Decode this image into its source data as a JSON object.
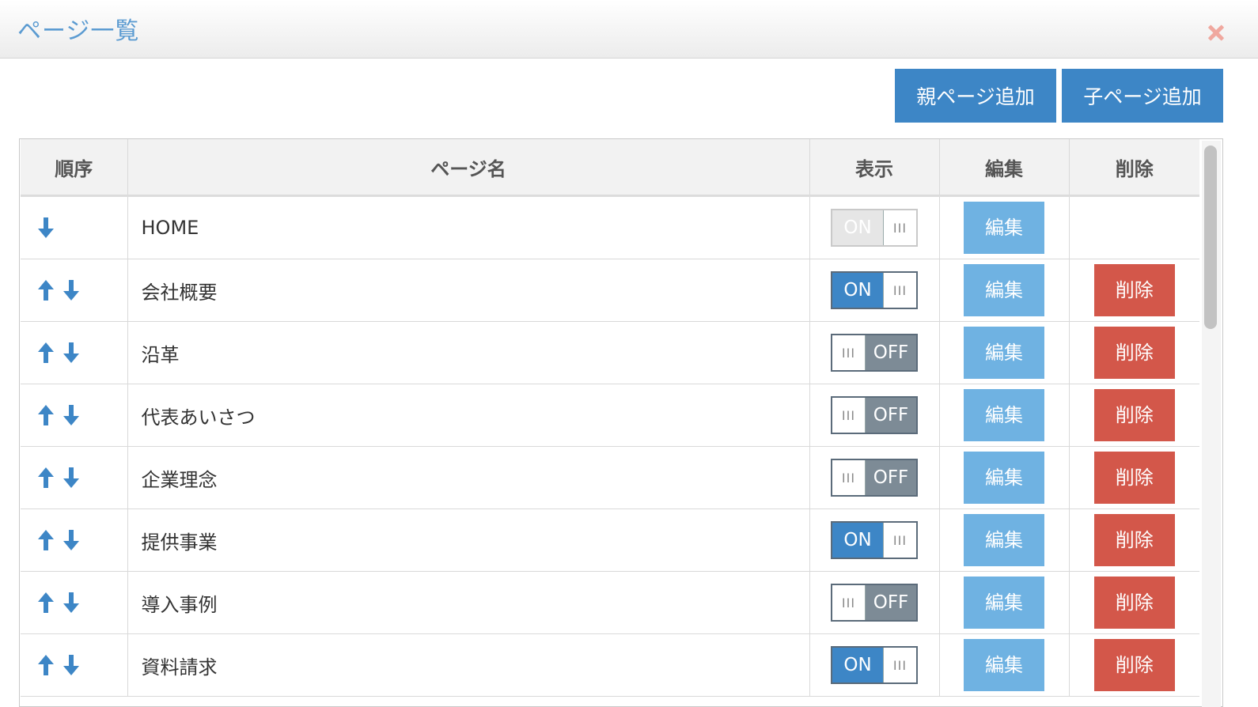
{
  "header": {
    "title": "ページ一覧",
    "close_icon": "close-x-icon",
    "close_color": "#f0a89f"
  },
  "toolbar": {
    "add_parent_label": "親ページ追加",
    "add_child_label": "子ページ追加",
    "accent": "#3d86c6"
  },
  "table": {
    "columns": [
      "順序",
      "ページ名",
      "表示",
      "編集",
      "削除"
    ],
    "rows": [
      {
        "name": "HOME",
        "up": false,
        "down": true,
        "toggle_label": "ON",
        "toggle_state": "disabled",
        "edit_label": "編集",
        "delete_label": ""
      },
      {
        "name": "会社概要",
        "up": true,
        "down": true,
        "toggle_label": "ON",
        "toggle_state": "on",
        "edit_label": "編集",
        "delete_label": "削除"
      },
      {
        "name": "沿革",
        "up": true,
        "down": true,
        "toggle_label": "OFF",
        "toggle_state": "off",
        "edit_label": "編集",
        "delete_label": "削除"
      },
      {
        "name": "代表あいさつ",
        "up": true,
        "down": true,
        "toggle_label": "OFF",
        "toggle_state": "off",
        "edit_label": "編集",
        "delete_label": "削除"
      },
      {
        "name": "企業理念",
        "up": true,
        "down": true,
        "toggle_label": "OFF",
        "toggle_state": "off",
        "edit_label": "編集",
        "delete_label": "削除"
      },
      {
        "name": "提供事業",
        "up": true,
        "down": true,
        "toggle_label": "ON",
        "toggle_state": "on",
        "edit_label": "編集",
        "delete_label": "削除"
      },
      {
        "name": "導入事例",
        "up": true,
        "down": true,
        "toggle_label": "OFF",
        "toggle_state": "off",
        "edit_label": "編集",
        "delete_label": "削除"
      },
      {
        "name": "資料請求",
        "up": true,
        "down": true,
        "toggle_label": "ON",
        "toggle_state": "on",
        "edit_label": "編集",
        "delete_label": "削除"
      }
    ],
    "knob_glyph": "III"
  },
  "colors": {
    "title": "#5b9bd1",
    "arrow": "#3d86c6",
    "edit": "#6fb2e2",
    "delete": "#d3574a",
    "toggle_on": "#3d86c6",
    "toggle_off": "#7d8b96"
  }
}
